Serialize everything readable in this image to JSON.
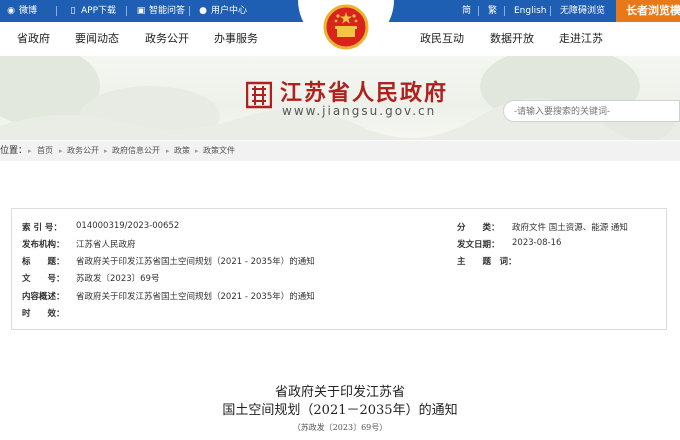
{
  "topbar": {
    "weibo": "微博",
    "app": "APP下载",
    "qa": "智能问答",
    "user": "用户中心",
    "simplified": "简",
    "traditional": "繁",
    "english": "English",
    "accessible": "无障碍浏览",
    "elder": "长者浏览模"
  },
  "nav": {
    "left": [
      "省政府",
      "要闻动态",
      "政务公开",
      "办事服务"
    ],
    "right": [
      "政民互动",
      "数据开放",
      "走进江苏"
    ]
  },
  "header": {
    "title": "江苏省人民政府",
    "url": "www.jiangsu.gov.cn",
    "search_placeholder": "-请输入要搜索的关键词-"
  },
  "breadcrumb": {
    "label": "位置：",
    "items": [
      "首页",
      "政务公开",
      "政府信息公开",
      "政策",
      "政策文件"
    ]
  },
  "meta": {
    "index_label": "索 引 号：",
    "index_value": "014000319/2023-00652",
    "category_label": "分　　类：",
    "category_value": "政府文件 国土资源、能源 通知",
    "issuer_label": "发布机构：",
    "issuer_value": "江苏省人民政府",
    "date_label": "发文日期：",
    "date_value": "2023-08-16",
    "title_label": "标　　题：",
    "title_value": "省政府关于印发江苏省国土空间规划（2021 - 2035年）的通知",
    "subject_label": "主　　题　词：",
    "subject_value": "",
    "docno_label": "文　　号：",
    "docno_value": "苏政发〔2023〕69号",
    "summary_label": "内容概述：",
    "summary_value": "省政府关于印发江苏省国土空间规划（2021 - 2035年）的通知",
    "validity_label": "时　　效：",
    "validity_value": ""
  },
  "document": {
    "title_line1": "省政府关于印发江苏省",
    "title_line2": "国土空间规划（2021－2035年）的通知",
    "doc_number": "（苏政发〔2023〕69号）"
  },
  "colors": {
    "topbar": "#1f5fb3",
    "elder_button": "#e8791b",
    "brand_red": "#b0201e"
  }
}
